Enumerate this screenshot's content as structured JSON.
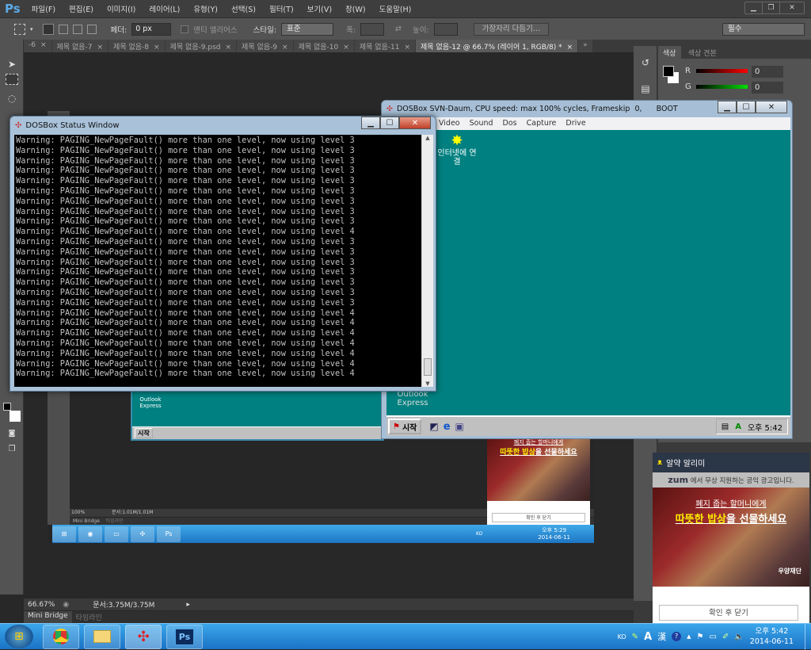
{
  "photoshop": {
    "logo": "Ps",
    "menu": [
      "파일(F)",
      "편집(E)",
      "이미지(I)",
      "레이어(L)",
      "유형(Y)",
      "선택(S)",
      "필터(T)",
      "보기(V)",
      "창(W)",
      "도움말(H)"
    ],
    "options": {
      "feather_label": "페더:",
      "feather_value": "0 px",
      "antialias_label": "앤티 앨리어스",
      "style_label": "스타일:",
      "style_value": "표준",
      "width_label": "폭:",
      "height_label": "높이:",
      "refine_edge": "가장자리 다듬기...",
      "workspace": "필수"
    },
    "tabs": [
      "-6",
      "제목 없음-7",
      "제목 없음-8",
      "제목 없음-9.psd",
      "제목 없음-9",
      "제목 없음-10",
      "제목 없음-11",
      "제목 없음-12 @ 66.7% (레이어 1, RGB/8) *"
    ],
    "close_glyph": "×",
    "overflow_glyph": "»",
    "panel": {
      "tabs": [
        "색상",
        "색상 견본"
      ],
      "r_label": "R",
      "r_value": "0",
      "g_label": "G",
      "g_value": "0"
    },
    "status": {
      "zoom": "66.67%",
      "doc": "문서:3.75M/3.75M"
    },
    "bottom_tabs": [
      "Mini Bridge",
      "타임라인"
    ]
  },
  "inner_screenshot": {
    "status_zoom": "100%",
    "status_doc": "문서:1.01M/1.01M",
    "bottom_tabs": [
      "Mini Bridge",
      "타임라인"
    ],
    "dos_icon_label": "Outlook Express",
    "start": "시작",
    "tray": {
      "lang": "KO",
      "time": "오후 5:29",
      "date": "2014-06-11"
    },
    "ad_line1": "폐지 줍는 할머니에게",
    "ad_line2_hl": "따뜻한 밥상",
    "ad_line2_rest": "을 선물하세요",
    "ad_button": "확인 후 닫기"
  },
  "dosbox": {
    "title": "DOSBox SVN-Daum, CPU speed: max 100% cycles, Frameskip  0,      BOOT",
    "menu": [
      "Video",
      "Sound",
      "Dos",
      "Capture",
      "Drive"
    ],
    "desktop_icons": [
      {
        "label": "인터넷에 연결"
      },
      {
        "label": "Outlook Express"
      }
    ],
    "start": "시작",
    "clock": "오후 5:42"
  },
  "status_window": {
    "title": "DOSBox Status Window",
    "lines": [
      "Warning: PAGING_NewPageFault() more than one level, now using level 3",
      "Warning: PAGING_NewPageFault() more than one level, now using level 3",
      "Warning: PAGING_NewPageFault() more than one level, now using level 3",
      "Warning: PAGING_NewPageFault() more than one level, now using level 3",
      "Warning: PAGING_NewPageFault() more than one level, now using level 3",
      "Warning: PAGING_NewPageFault() more than one level, now using level 3",
      "Warning: PAGING_NewPageFault() more than one level, now using level 3",
      "Warning: PAGING_NewPageFault() more than one level, now using level 3",
      "Warning: PAGING_NewPageFault() more than one level, now using level 3",
      "Warning: PAGING_NewPageFault() more than one level, now using level 4",
      "Warning: PAGING_NewPageFault() more than one level, now using level 3",
      "Warning: PAGING_NewPageFault() more than one level, now using level 3",
      "Warning: PAGING_NewPageFault() more than one level, now using level 3",
      "Warning: PAGING_NewPageFault() more than one level, now using level 3",
      "Warning: PAGING_NewPageFault() more than one level, now using level 3",
      "Warning: PAGING_NewPageFault() more than one level, now using level 3",
      "Warning: PAGING_NewPageFault() more than one level, now using level 3",
      "Warning: PAGING_NewPageFault() more than one level, now using level 4",
      "Warning: PAGING_NewPageFault() more than one level, now using level 4",
      "Warning: PAGING_NewPageFault() more than one level, now using level 4",
      "Warning: PAGING_NewPageFault() more than one level, now using level 4",
      "Warning: PAGING_NewPageFault() more than one level, now using level 4",
      "Warning: PAGING_NewPageFault() more than one level, now using level 4",
      "Warning: PAGING_NewPageFault() more than one level, now using level 4"
    ]
  },
  "ad_popup": {
    "title": "알약 알리미",
    "sub_brand": "zum",
    "sub_text": " 에서 무상 지원하는 공익 광고입니다.",
    "line1": "폐지 줍는 할머니에게",
    "line2_hl": "따뜻한 밥상",
    "line2_rest": "을 선물하세요",
    "logo_text": "우양재단",
    "button": "확인 후 닫기"
  },
  "taskbar": {
    "apps": [
      "Chrome",
      "Explorer",
      "DOSBox",
      "Ps"
    ],
    "tray": {
      "lang": "KO",
      "ime_a": "A",
      "ime_han": "漢",
      "time": "오후 5:42",
      "date": "2014-06-11"
    }
  },
  "colors": {
    "ps_bg": "#282828",
    "teal": "#008080",
    "taskbar": "#1a73c6",
    "ad_highlight": "#ffef00"
  }
}
